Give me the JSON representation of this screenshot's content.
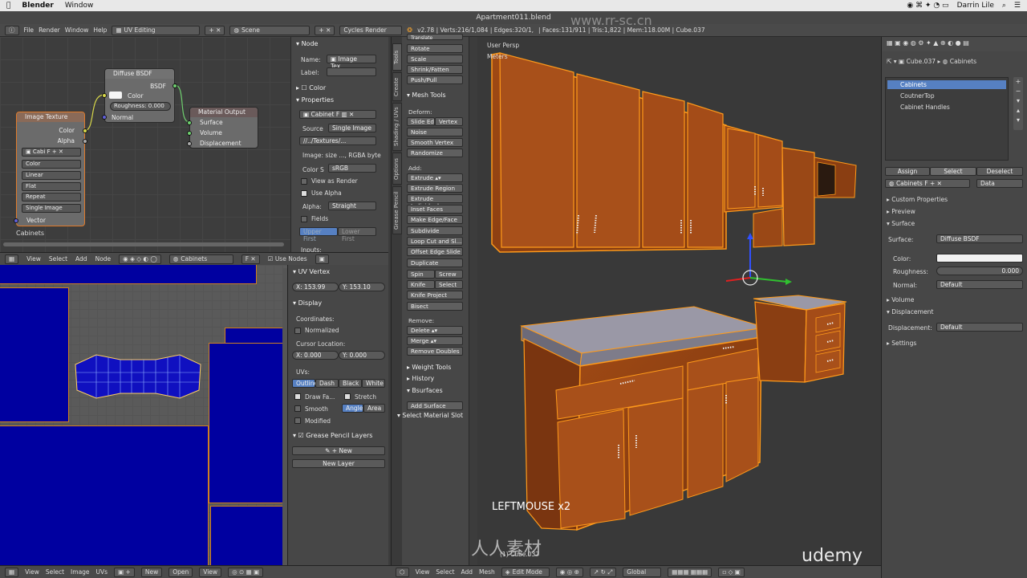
{
  "mac_menu": {
    "app": "Blender",
    "window": "Window",
    "user": "Darrin Lile"
  },
  "window_title": "Apartment011.blend",
  "top_bar": {
    "menus": [
      "File",
      "Render",
      "Window",
      "Help"
    ],
    "layout": "UV Editing",
    "scene": "Scene",
    "engine": "Cycles Render",
    "stats": "v2.78 | Verts:216/1,084 | Edges:320/1,",
    "stats2": "| Faces:131/911 | Tris:1,822 | Mem:118.00M | Cube.037"
  },
  "node_editor": {
    "image_texture": {
      "title": "Image Texture",
      "outputs": [
        "Color",
        "Alpha"
      ],
      "image": "Cabi",
      "color": "Color",
      "interp": "Linear",
      "proj": "Flat",
      "ext": "Repeat",
      "source": "Single Image",
      "input": "Vector"
    },
    "diffuse": {
      "title": "Diffuse BSDF",
      "output": "BSDF",
      "color": "Color",
      "roughness": "Roughness: 0.000",
      "normal": "Normal"
    },
    "material_output": {
      "title": "Material Output",
      "inputs": [
        "Surface",
        "Volume",
        "Displacement"
      ]
    },
    "material_name": "Cabinets",
    "header": {
      "menus": [
        "View",
        "Select",
        "Add",
        "Node"
      ],
      "material": "Cabinets",
      "use_nodes": "Use Nodes"
    }
  },
  "node_panel": {
    "node_head": "Node",
    "name_label": "Name:",
    "name_value": "Image Tex...",
    "label_label": "Label:",
    "color_head": "Color",
    "properties_head": "Properties",
    "image_name": "Cabinet",
    "image_f": "F",
    "source_label": "Source",
    "source_value": "Single Image",
    "path": "//../Textures/...",
    "image_size": "Image: size ..., RGBA byte",
    "color_space_label": "Color S",
    "color_space": "sRGB",
    "view_as_render": "View as Render",
    "use_alpha": "Use Alpha",
    "alpha_label": "Alpha:",
    "alpha_value": "Straight",
    "fields": "Fields",
    "upper_first": "Upper First",
    "lower_first": "Lower First",
    "inputs": "Inputs:"
  },
  "uv_panel": {
    "uv_vertex": "UV Vertex",
    "x": "X:  153.99",
    "y": "Y:  153.10",
    "display": "Display",
    "coords": "Coordinates:",
    "normalized": "Normalized",
    "cursor_location": "Cursor Location:",
    "cx": "X:   0.000",
    "cy": "Y:   0.000",
    "uvs": "UVs:",
    "uv_modes": [
      "Outline",
      "Dash",
      "Black",
      "White"
    ],
    "draw_faces": "Draw Fa...",
    "stretch": "Stretch",
    "smooth": "Smooth",
    "angle": "Angle",
    "area": "Area",
    "modified": "Modified",
    "grease": "Grease Pencil Layers",
    "new": "New",
    "new_layer": "New Layer"
  },
  "uv_bottom": {
    "menus": [
      "View",
      "Select",
      "Image",
      "UVs"
    ],
    "new": "New",
    "open": "Open",
    "view": "View"
  },
  "tool_tabs": [
    "Tools",
    "Create",
    "Shading / UVs",
    "Options",
    "Grease Pencil"
  ],
  "tools": {
    "top_cut": "Translate",
    "transform": [
      "Rotate",
      "Scale",
      "Shrink/Fatten",
      "Push/Pull"
    ],
    "mesh_tools": "Mesh Tools",
    "deform": "Deform:",
    "slide_edge": "Slide Ed",
    "vertex": "Vertex",
    "deform_items": [
      "Noise",
      "Smooth Vertex",
      "Randomize"
    ],
    "add": "Add:",
    "add_items": [
      "Extrude",
      "Extrude Region",
      "Extrude Individual",
      "Inset Faces",
      "Make Edge/Face",
      "Subdivide",
      "Loop Cut and Sl...",
      "Offset Edge Slide",
      "Duplicate"
    ],
    "spin": "Spin",
    "screw": "Screw",
    "knife": "Knife",
    "select": "Select",
    "knife_project": "Knife Project",
    "bisect": "Bisect",
    "remove": "Remove:",
    "delete": "Delete",
    "merge": "Merge",
    "remove_doubles": "Remove Doubles",
    "weight_tools": "Weight Tools",
    "history": "History",
    "bsurfaces": "Bsurfaces",
    "add_surface": "Add Surface",
    "select_material_slot": "Select Material Slot"
  },
  "viewport": {
    "view_name": "User Persp",
    "units": "Meters",
    "operator": "LEFTMOUSE x2",
    "object": "(1) Cube.037",
    "menus": [
      "View",
      "Select",
      "Add",
      "Mesh"
    ],
    "mode": "Edit Mode",
    "orientation": "Global"
  },
  "properties": {
    "breadcrumb_obj": "Cube.037",
    "breadcrumb_mat": "Cabinets",
    "slots": [
      "Cabinets",
      "CoutnerTop",
      "Cabinet Handles"
    ],
    "assign": "Assign",
    "select": "Select",
    "deselect": "Deselect",
    "material": "Cabinets",
    "f": "F",
    "link": "Data",
    "custom_properties": "Custom Properties",
    "preview": "Preview",
    "surface_head": "Surface",
    "surface_label": "Surface:",
    "surface_value": "Diffuse BSDF",
    "color_label": "Color:",
    "roughness_label": "Roughness:",
    "roughness_value": "0.000",
    "normal_label": "Normal:",
    "normal_value": "Default",
    "volume": "Volume",
    "displacement_head": "Displacement",
    "displacement_label": "Displacement:",
    "displacement_value": "Default",
    "settings": "Settings"
  },
  "watermark": {
    "site": "www.rr-sc.cn",
    "brand": "人人素材",
    "udemy": "udemy"
  },
  "colors": {
    "select": "#5680c2",
    "uv_blue": "#0000a0",
    "wood": "#b8561a",
    "edge": "#ff9a1a"
  }
}
